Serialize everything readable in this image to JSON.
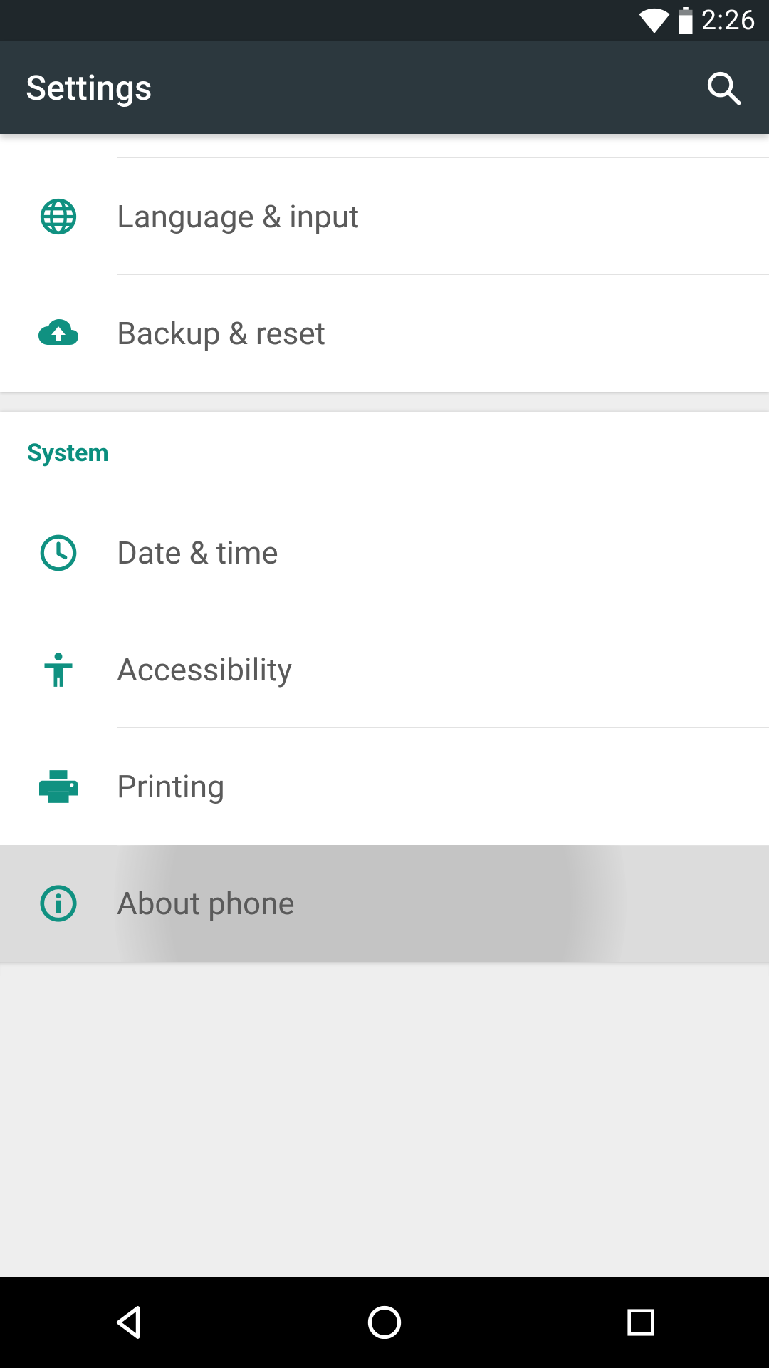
{
  "status": {
    "time": "2:26"
  },
  "appbar": {
    "title": "Settings"
  },
  "panel1": {
    "items": [
      {
        "label": "Language & input"
      },
      {
        "label": "Backup & reset"
      }
    ]
  },
  "panel2": {
    "header": "System",
    "items": [
      {
        "label": "Date & time"
      },
      {
        "label": "Accessibility"
      },
      {
        "label": "Printing"
      },
      {
        "label": "About phone"
      }
    ]
  }
}
